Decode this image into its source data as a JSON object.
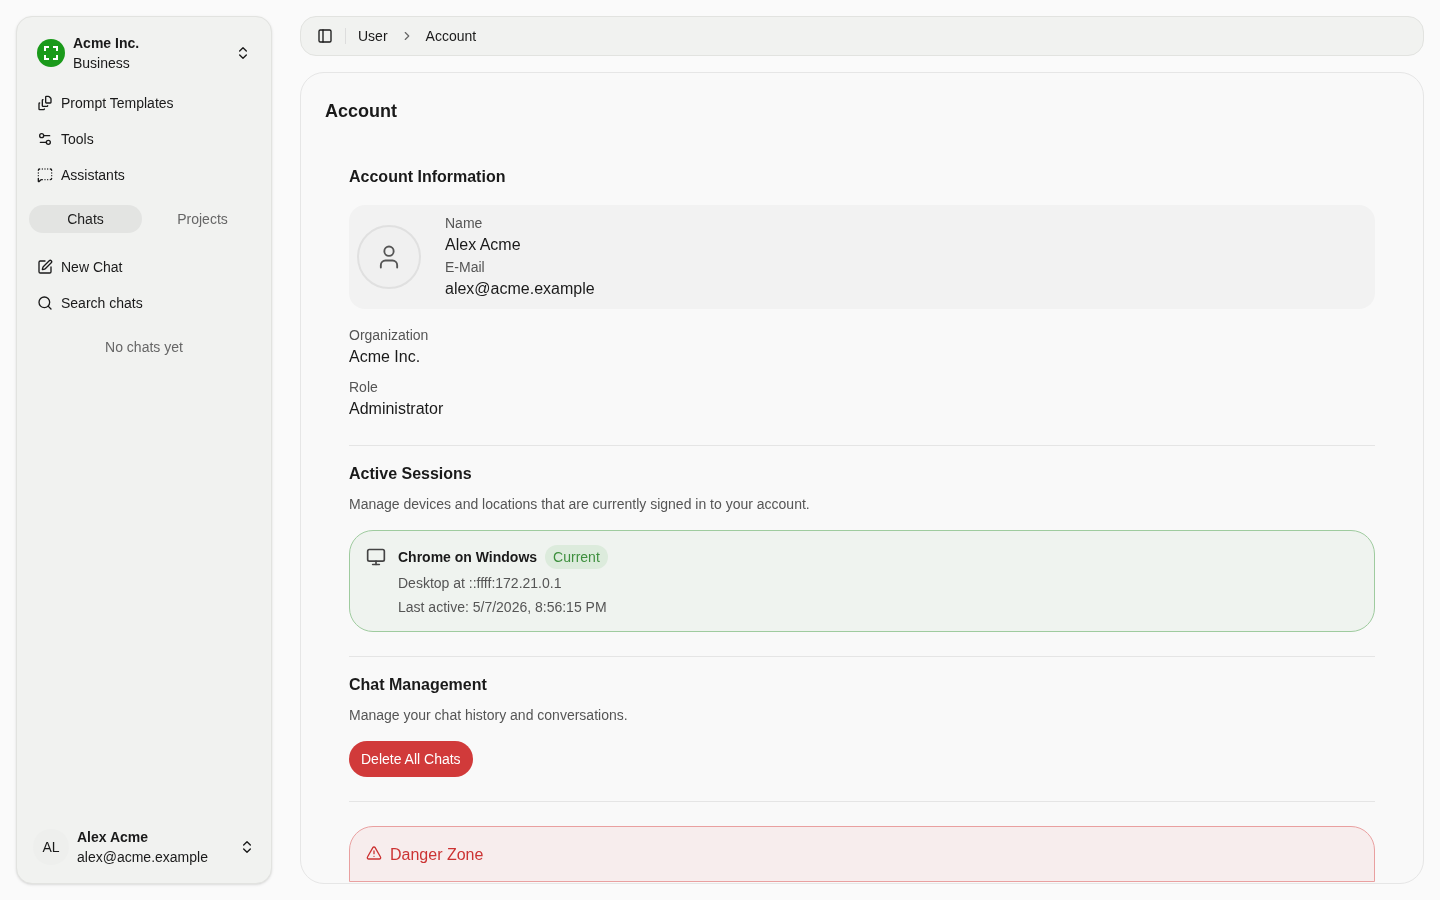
{
  "org": {
    "name": "Acme Inc.",
    "plan": "Business"
  },
  "nav": [
    {
      "kind": "templates",
      "label": "Prompt Templates"
    },
    {
      "kind": "tools",
      "label": "Tools"
    },
    {
      "kind": "assistants",
      "label": "Assistants"
    }
  ],
  "tabs": [
    {
      "label": "Chats",
      "selected": true
    },
    {
      "label": "Projects",
      "selected": false
    }
  ],
  "chat_actions": [
    {
      "kind": "new",
      "label": "New Chat"
    },
    {
      "kind": "search",
      "label": "Search chats"
    }
  ],
  "empty_text": "No chats yet",
  "user": {
    "initials": "AL",
    "name": "Alex Acme",
    "email": "alex@acme.example"
  },
  "breadcrumb": [
    "User",
    "Account"
  ],
  "page_title": "Account",
  "account_info": {
    "title": "Account Information",
    "fields": [
      {
        "label": "Name",
        "value": "Alex Acme"
      },
      {
        "label": "E-Mail",
        "value": "alex@acme.example"
      }
    ],
    "extra_fields": [
      {
        "label": "Organization",
        "value": "Acme Inc."
      },
      {
        "label": "Role",
        "value": "Administrator"
      }
    ]
  },
  "sessions": {
    "title": "Active Sessions",
    "description": "Manage devices and locations that are currently signed in to your account.",
    "items": [
      {
        "device": "Chrome on Windows",
        "badge": "Current",
        "current": true,
        "location": "Desktop at ::ffff:172.21.0.1",
        "last_active": "Last active: 5/7/2026, 8:56:15 PM"
      }
    ]
  },
  "chat_management": {
    "title": "Chat Management",
    "description": "Manage your chat history and conversations.",
    "button": "Delete All Chats"
  },
  "danger_zone": {
    "title": "Danger Zone"
  }
}
